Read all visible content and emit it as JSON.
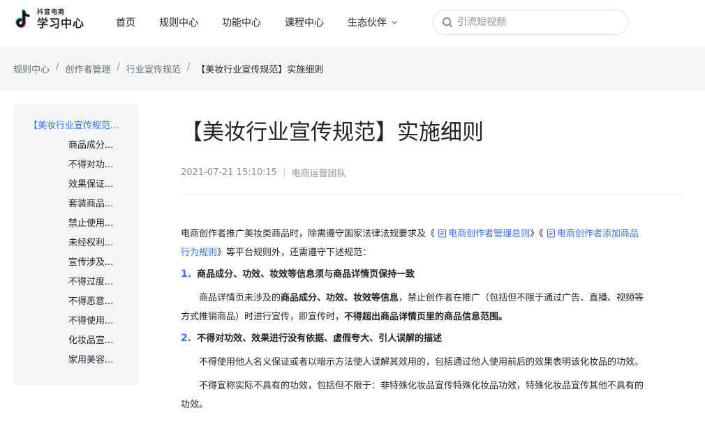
{
  "header": {
    "logo_small": "抖音电商",
    "logo_big": "学习中心",
    "nav": [
      "首页",
      "规则中心",
      "功能中心",
      "课程中心",
      "生态伙伴"
    ],
    "search_placeholder": "引流短视频"
  },
  "breadcrumb": [
    "规则中心",
    "创作者管理",
    "行业宣传规范",
    "【美妆行业宣传规范】实施细则"
  ],
  "toc": {
    "top": "【美妆行业宣传规范...",
    "items": [
      "商品成分...",
      "不得对功...",
      "效果保证...",
      "套装商品...",
      "禁止使用...",
      "未经权利...",
      "宣传涉及...",
      "不得过度...",
      "不得恶意...",
      "不得使用...",
      "化妆品宣...",
      "家用美容..."
    ]
  },
  "article": {
    "title": "【美妆行业宣传规范】实施细则",
    "date": "2021-07-21 15:10:15",
    "author": "电商运营团队",
    "intro_a": "电商创作者推广美妆类商品时，除需遵守国家法律法规要求及《",
    "link1": "电商创作者管理总则",
    "intro_b": "》《",
    "link2a": "电商创作者添加商品",
    "link2b": "行为规则",
    "intro_c": "》等平台规则外，还需遵守下述规范：",
    "s1_num": "1.",
    "s1_title": "商品成分、功效、妆效等信息须与商品详情页保持一致",
    "s1_a": "商品详情页未涉及的",
    "s1_b": "商品成分、功效、妆效等信息",
    "s1_c": "，禁止创作者在推广（包括但不限于通过广告、直播、视频等",
    "s1_d": "方式推销商品）时进行宣传，即宣传时，",
    "s1_e": "不得超出商品详情页里的商品信息范围。",
    "s2_num": "2.",
    "s2_title": "不得对功效、效果进行没有依据、虚假夸大、引人误解的描述",
    "s2_p1": "不得使用他人名义保证或者以暗示方法使人误解其效用的，包括通过他人使用前后的效果表明该化妆品的功效。",
    "s2_p2a": "不得宣称实际不具有的功效，包括但不限于：非特殊化妆品宣传特殊化妆品功效，特殊化妆品宣传其他不具有的",
    "s2_p2b": "功效。"
  },
  "colors": {
    "accent": "#3370ff",
    "panel": "#f5f6f7"
  }
}
